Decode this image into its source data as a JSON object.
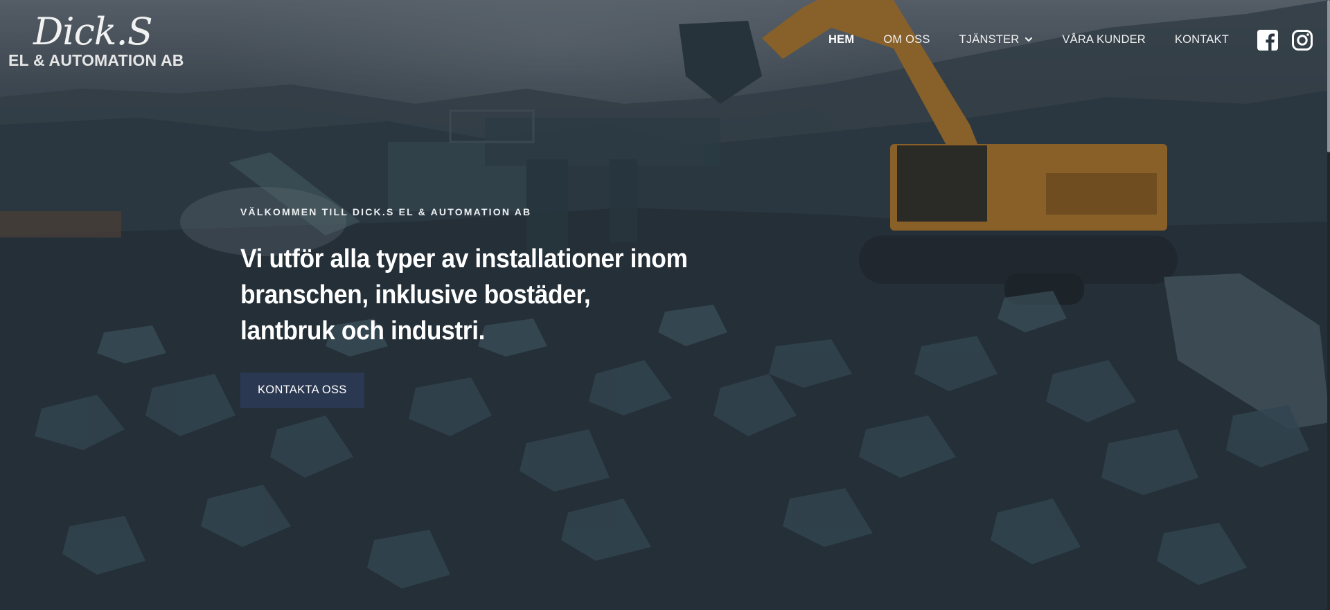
{
  "brand": {
    "logo_script": "Dick.S",
    "logo_subtitle": "EL & AUTOMATION AB"
  },
  "nav": {
    "items": [
      {
        "label": "HEM",
        "active": true
      },
      {
        "label": "OM OSS",
        "active": false
      },
      {
        "label": "TJÄNSTER",
        "active": false,
        "has_dropdown": true
      },
      {
        "label": "VÅRA KUNDER",
        "active": false
      },
      {
        "label": "KONTAKT",
        "active": false
      }
    ],
    "social": [
      {
        "icon": "facebook-icon"
      },
      {
        "icon": "instagram-icon"
      }
    ]
  },
  "hero": {
    "eyebrow": "VÄLKOMMEN TILL DICK.S EL & AUTOMATION AB",
    "headline": "Vi utför alla typer av installationer inom branschen, inklusive bostäder, lantbruk och industri.",
    "cta_label": "KONTAKTA OSS"
  },
  "colors": {
    "cta_background": "#2b3852",
    "text": "#ffffff",
    "excavator_orange": "#b77a2c"
  }
}
